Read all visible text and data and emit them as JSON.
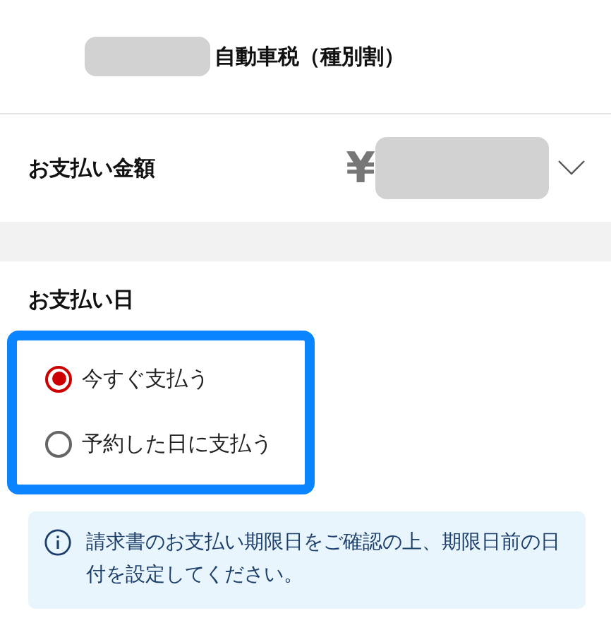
{
  "header": {
    "title": "自動車税（種別割）"
  },
  "amount": {
    "label": "お支払い金額",
    "currency": "¥",
    "expanded": false
  },
  "payment_date": {
    "label": "お支払い日",
    "options": [
      {
        "label": "今すぐ支払う",
        "selected": true
      },
      {
        "label": "予約した日に支払う",
        "selected": false
      }
    ]
  },
  "notice": {
    "text": "請求書のお支払い期限日をご確認の上、期限日前の日付を設定してください。"
  }
}
